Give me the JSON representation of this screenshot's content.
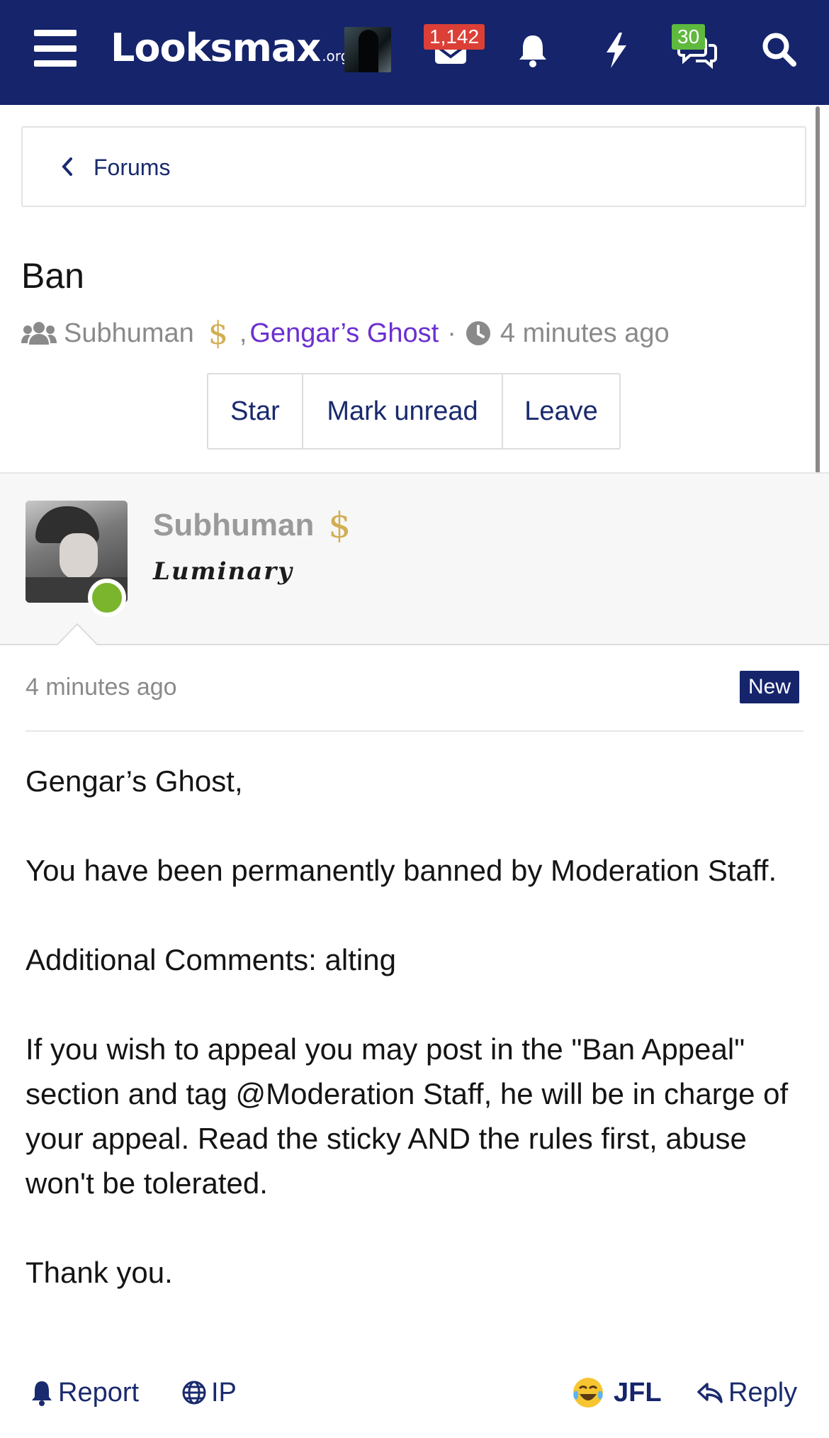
{
  "nav": {
    "logo_main": "Looksmax",
    "logo_tld": ".org",
    "inbox_badge": "1,142",
    "conversations_badge": "30",
    "colors": {
      "bar": "#15246b",
      "badge_red": "#dc3f36",
      "badge_green": "#5fb93e"
    }
  },
  "breadcrumb": {
    "label": "Forums"
  },
  "conversation": {
    "title": "Ban",
    "participant_1": "Subhuman",
    "participant_2": "Gengar’s Ghost",
    "participant_2_color": "#6b2fd0",
    "separator": "·",
    "comma": ",",
    "time": "4 minutes ago",
    "actions": {
      "star": "Star",
      "mark_unread": "Mark unread",
      "leave": "Leave"
    }
  },
  "post": {
    "author": "Subhuman",
    "author_symbol": "$",
    "author_title": "Luminary",
    "time": "4 minutes ago",
    "new_badge": "New",
    "body": {
      "greeting": "Gengar’s Ghost,",
      "line_1": "You have been permanently banned by Moderation Staff.",
      "line_2": "Additional Comments: alting",
      "line_3": "If you wish to appeal you may post in the \"Ban Appeal\" section and tag @Moderation Staff, he will be in charge of your appeal. Read the sticky AND the rules first, abuse won't be tolerated.",
      "closing": "Thank you."
    },
    "footer": {
      "report": "Report",
      "ip": "IP",
      "reaction": "JFL",
      "reply": "Reply"
    }
  }
}
